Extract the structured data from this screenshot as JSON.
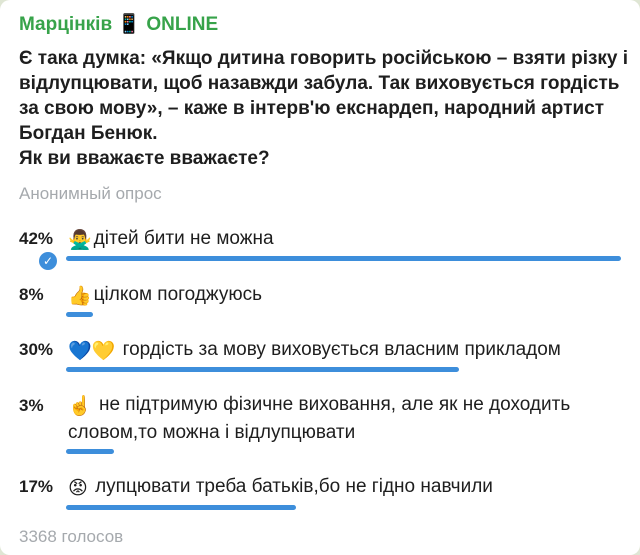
{
  "channel": {
    "name": "Марцінків 📱 ONLINE"
  },
  "poll": {
    "question_line1": "Є така думка: «Якщо дитина говорить російською – взяти різку і відлупцювати, щоб назавжди забула. Так виховується гордість за свою мову», – каже в інтерв'ю екснардеп, народний артист Богдан Бенюк.",
    "question_line2": "Як ви вважаєте вважаєте?",
    "type_label": "Анонимный опрос",
    "options": [
      {
        "percent_text": "42%",
        "percent": 42,
        "emoji": "🙅‍♂️",
        "text": "дітей бити не можна",
        "chosen": true,
        "bar_fraction": 1.0
      },
      {
        "percent_text": "8%",
        "percent": 8,
        "emoji": "👍",
        "text": "цілком погоджуюсь",
        "chosen": false,
        "bar_fraction": 0.19
      },
      {
        "percent_text": "30%",
        "percent": 30,
        "emoji": "💙💛",
        "text": " гордість за мову виховується власним прикладом",
        "chosen": false,
        "bar_fraction": 0.71
      },
      {
        "percent_text": "3%",
        "percent": 3,
        "emoji": "☝️",
        "text": " не підтримую фізичне виховання, але як не доходить словом,то можна і відлупцювати",
        "chosen": false,
        "bar_fraction": 0.07
      },
      {
        "percent_text": "17%",
        "percent": 17,
        "emoji": "😡",
        "text": " лупцювати треба батьків,бо не гідно навчили",
        "chosen": false,
        "bar_fraction": 0.4
      }
    ],
    "votes_label": "3368 голосов"
  },
  "colors": {
    "channel_name": "#37a34a",
    "bar": "#3d8edb",
    "muted_text": "#a5a9ad"
  }
}
